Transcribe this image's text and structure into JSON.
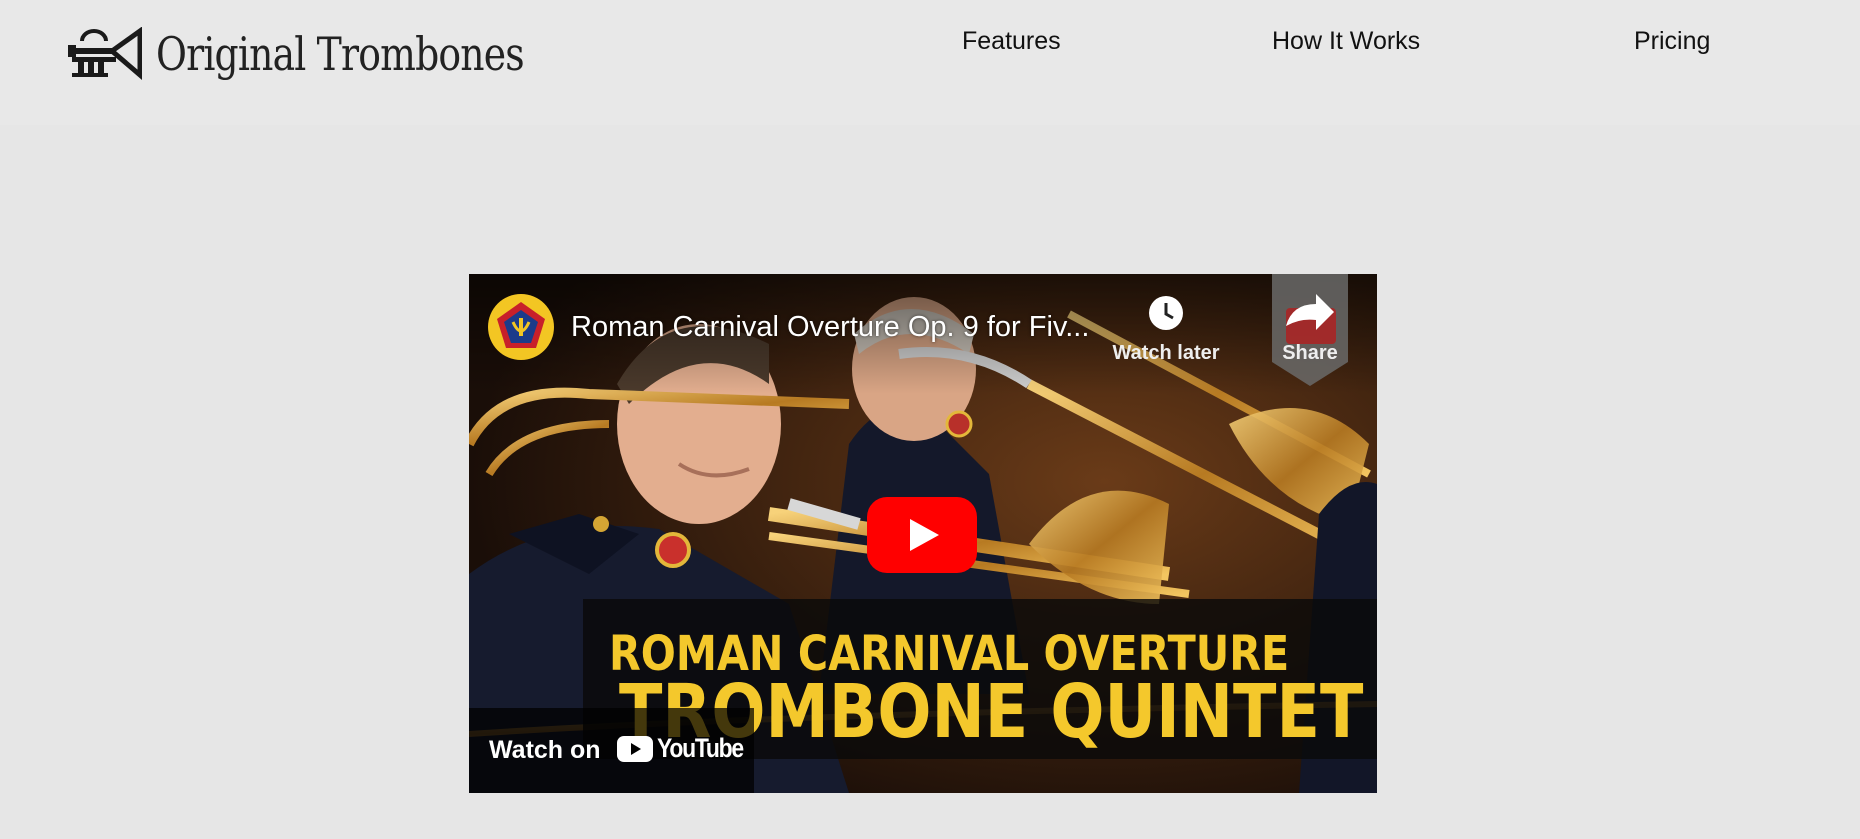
{
  "brand": {
    "name": "Original Trombones",
    "logo_icon": "trumpet-icon"
  },
  "nav": {
    "items": [
      {
        "label": "Features"
      },
      {
        "label": "How It Works"
      },
      {
        "label": "Pricing"
      }
    ]
  },
  "video": {
    "title": "Roman Carnival Overture Op. 9 for Fiv...",
    "watch_later_label": "Watch later",
    "share_label": "Share",
    "caption_line1": "ROMAN CARNIVAL OVERTURE",
    "caption_line2": "TROMBONE QUINTET",
    "watch_on_label": "Watch on",
    "youtube_label": "YouTube",
    "colors": {
      "play_red": "#ff0000",
      "caption_yellow": "#f4c82c"
    }
  }
}
